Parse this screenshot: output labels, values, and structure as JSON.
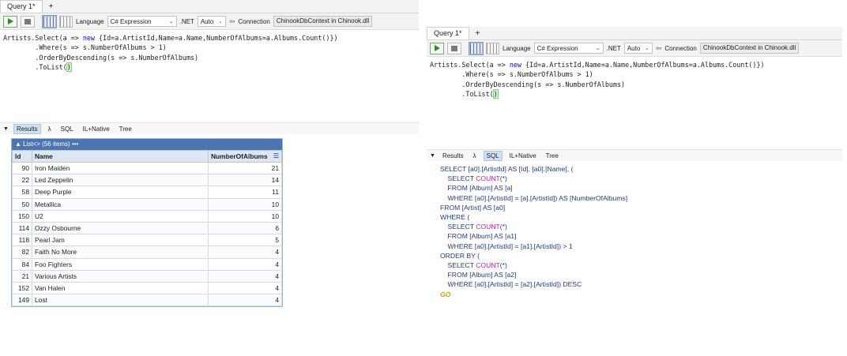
{
  "left": {
    "tab": "Query 1*",
    "tab_add": "+",
    "language_label": "Language",
    "language_value": "C# Expression",
    "net_label": ".NET",
    "net_value": "Auto",
    "connection_label": "Connection",
    "connection_value": "ChinookDbContext in Chinook.dll",
    "code": {
      "l1a": "Artists.Select(a => ",
      "l1kw": "new",
      "l1b": " {Id=a.ArtistId,Name=a.Name,NumberOfAlbums=a.Albums.Count()})",
      "l2": "        .Where(s => s.NumberOfAlbums > 1)",
      "l3": "        .OrderByDescending(s => s.NumberOfAlbums)",
      "l4a": "        .ToList(",
      "l4b": ")"
    },
    "results_tabs": [
      "Results",
      "λ",
      "SQL",
      "IL+Native",
      "Tree"
    ],
    "list_header": "List<> (56 items)",
    "list_more": "•••",
    "columns": [
      "Id",
      "Name",
      "NumberOfAlbums"
    ],
    "rows": [
      [
        "90",
        "Iron Maiden",
        "21"
      ],
      [
        "22",
        "Led Zeppelin",
        "14"
      ],
      [
        "58",
        "Deep Purple",
        "11"
      ],
      [
        "50",
        "Metallica",
        "10"
      ],
      [
        "150",
        "U2",
        "10"
      ],
      [
        "114",
        "Ozzy Osbourne",
        "6"
      ],
      [
        "118",
        "Pearl Jam",
        "5"
      ],
      [
        "82",
        "Faith No More",
        "4"
      ],
      [
        "84",
        "Foo Fighters",
        "4"
      ],
      [
        "21",
        "Various Artists",
        "4"
      ],
      [
        "152",
        "Van Halen",
        "4"
      ],
      [
        "149",
        "Lost",
        "4"
      ]
    ]
  },
  "right": {
    "tab": "Query 1*",
    "tab_add": "+",
    "language_label": "Language",
    "language_value": "C# Expression",
    "net_label": ".NET",
    "net_value": "Auto",
    "connection_label": "Connection",
    "connection_value": "ChinookDbContext in Chinook.dll",
    "results_tabs": [
      "Results",
      "λ",
      "SQL",
      "IL+Native",
      "Tree"
    ],
    "sql": {
      "s1": "SELECT [a0].[ArtistId] AS [Id], [a0].[Name], (",
      "s2a": "    SELECT ",
      "s2f": "COUNT",
      "s2b": "(*)",
      "s3": "    FROM [Album] AS [a]",
      "s4": "    WHERE [a0].[ArtistId] = [a].[ArtistId]) AS [NumberOfAlbums]",
      "s5": "FROM [Artist] AS [a0]",
      "s6": "WHERE (",
      "s7a": "    SELECT ",
      "s7f": "COUNT",
      "s7b": "(*)",
      "s8": "    FROM [Album] AS [a1]",
      "s9": "    WHERE [a0].[ArtistId] = [a1].[ArtistId]) > 1",
      "s10": "ORDER BY (",
      "s11a": "    SELECT ",
      "s11f": "COUNT",
      "s11b": "(*)",
      "s12": "    FROM [Album] AS [a2]",
      "s13": "    WHERE [a0].[ArtistId] = [a2].[ArtistId]) DESC",
      "s14": "GO"
    }
  }
}
